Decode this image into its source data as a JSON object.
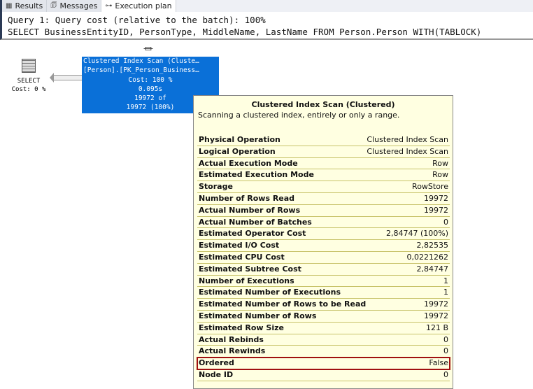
{
  "tabs": [
    {
      "label": "Results",
      "icon": "grid-icon"
    },
    {
      "label": "Messages",
      "icon": "messages-icon"
    },
    {
      "label": "Execution plan",
      "icon": "plan-icon"
    }
  ],
  "query": {
    "line1": "Query 1: Query cost (relative to the batch): 100%",
    "line2": "SELECT BusinessEntityID, PersonType, MiddleName, LastName FROM Person.Person WITH(TABLOCK)"
  },
  "select_node": {
    "label": "SELECT",
    "cost": "Cost: 0 %"
  },
  "scan_node": {
    "line1": "Clustered Index Scan (Cluste…",
    "line2": "[Person].[PK_Person_Business…",
    "cost": "Cost: 100 %",
    "time": "0.095s",
    "rows1": "19972 of",
    "rows2": "19972 (100%)"
  },
  "tooltip": {
    "title": "Clustered Index Scan (Clustered)",
    "description": "Scanning a clustered index, entirely or only a range.",
    "rows": [
      [
        "Physical Operation",
        "Clustered Index Scan"
      ],
      [
        "Logical Operation",
        "Clustered Index Scan"
      ],
      [
        "Actual Execution Mode",
        "Row"
      ],
      [
        "Estimated Execution Mode",
        "Row"
      ],
      [
        "Storage",
        "RowStore"
      ],
      [
        "Number of Rows Read",
        "19972"
      ],
      [
        "Actual Number of Rows",
        "19972"
      ],
      [
        "Actual Number of Batches",
        "0"
      ],
      [
        "Estimated Operator Cost",
        "2,84747 (100%)"
      ],
      [
        "Estimated I/O Cost",
        "2,82535"
      ],
      [
        "Estimated CPU Cost",
        "0,0221262"
      ],
      [
        "Estimated Subtree Cost",
        "2,84747"
      ],
      [
        "Number of Executions",
        "1"
      ],
      [
        "Estimated Number of Executions",
        "1"
      ],
      [
        "Estimated Number of Rows to be Read",
        "19972"
      ],
      [
        "Estimated Number of Rows",
        "19972"
      ],
      [
        "Estimated Row Size",
        "121 B"
      ],
      [
        "Actual Rebinds",
        "0"
      ],
      [
        "Actual Rewinds",
        "0"
      ],
      [
        "Ordered",
        "False"
      ],
      [
        "Node ID",
        "0"
      ]
    ],
    "highlighted_row": "Ordered"
  }
}
